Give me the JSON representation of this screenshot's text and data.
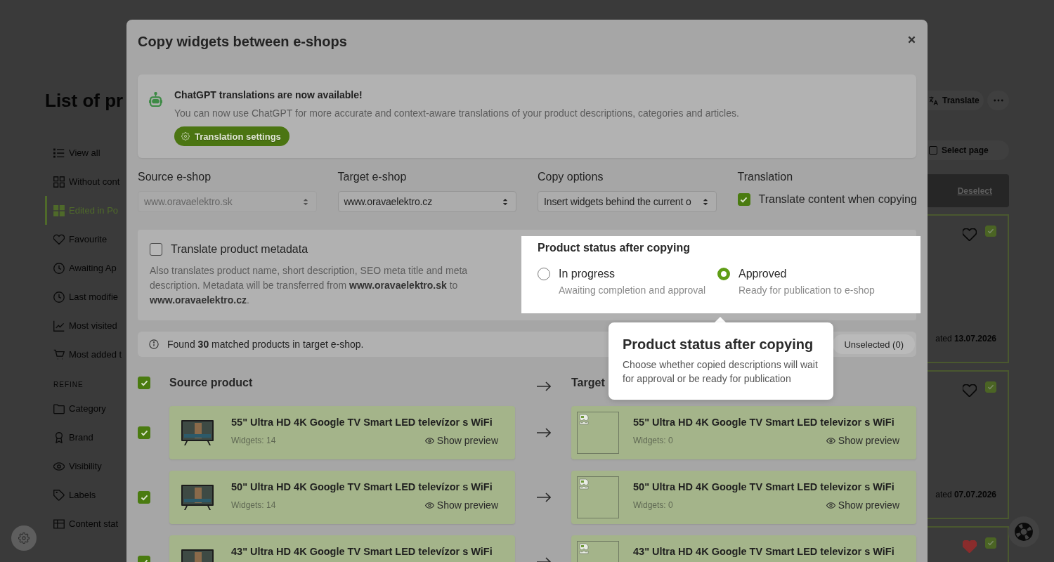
{
  "background": {
    "page_title": "List of pr",
    "sidebar": {
      "views": [
        {
          "label": "View all",
          "selected": false
        },
        {
          "label": "Without cont",
          "selected": false
        },
        {
          "label": "Edited in Po",
          "selected": true
        },
        {
          "label": "Favourite",
          "selected": false
        },
        {
          "label": "Awaiting Ap",
          "selected": false
        },
        {
          "label": "Last modifie",
          "selected": false
        },
        {
          "label": "Most visited",
          "selected": false
        },
        {
          "label": "Most added t",
          "selected": false
        }
      ],
      "section_heading": "REFINE",
      "filters": [
        "Category",
        "Brand",
        "Visibility",
        "Labels",
        "Content stat"
      ]
    },
    "toolbar": {
      "translate_button": "Translate",
      "select_page": {
        "label": "Select page",
        "checked": false
      },
      "deselect_link": "Deselect"
    },
    "cards": [
      {
        "favourite": false,
        "checked": true,
        "updated": "ated **13.07.2026**"
      },
      {
        "favourite": false,
        "checked": true,
        "updated": "ated **07.07.2026**"
      },
      {
        "favourite": true,
        "checked": true
      }
    ]
  },
  "modal": {
    "title": "Copy widgets between e-shops",
    "notice": {
      "title": "ChatGPT translations are now available!",
      "text": "You can now use ChatGPT for more accurate and context-aware translations of your product descriptions, categories and articles.",
      "button": "Translation settings"
    },
    "fields": [
      {
        "kind": "select",
        "label": "Source e-shop",
        "value": "www.oravaelektro.sk",
        "disabled": true
      },
      {
        "kind": "select",
        "label": "Target e-shop",
        "value": "www.oravaelektro.cz",
        "disabled": false
      },
      {
        "kind": "select",
        "label": "Copy options",
        "value": "Insert widgets behind the current o",
        "disabled": false
      },
      {
        "kind": "checkbox",
        "label": "Translation",
        "option": "Translate content when copying",
        "checked": true
      }
    ],
    "metadata": {
      "label": "Translate product metadata",
      "checked": false,
      "description": "Also translates product name, short description, SEO meta title and meta description. Metadata will be transferred from **www.oravaelektro.sk** to **www.oravaelektro.cz**."
    },
    "status": {
      "title": "Product status after copying",
      "options": [
        {
          "label": "In progress",
          "description": "Awaiting completion and approval",
          "selected": false
        },
        {
          "label": "Approved",
          "description": "Ready for publication to e-shop",
          "selected": true
        }
      ]
    },
    "summary": {
      "text": "Found **30** matched products in target e-shop.",
      "unselected_button": "Unselected (0)"
    },
    "list": {
      "all_checked": true,
      "source_heading": "Source product",
      "target_heading": "Target",
      "rows": [
        {
          "checked": true,
          "source": {
            "title": "55\" Ultra HD 4K Google TV Smart LED televízor s WiFi",
            "widgets": "Widgets: 14",
            "preview": "Show preview"
          },
          "target": {
            "title": "55\" Ultra HD 4K Google TV Smart LED televizor s WiFi",
            "widgets": "Widgets: 0",
            "preview": "Show preview"
          }
        },
        {
          "checked": true,
          "source": {
            "title": "50\" Ultra HD 4K Google TV Smart LED televízor s WiFi",
            "widgets": "Widgets: 14",
            "preview": "Show preview"
          },
          "target": {
            "title": "50\" Ultra HD 4K Google TV Smart LED televizor s WiFi",
            "widgets": "Widgets: 0",
            "preview": "Show preview"
          }
        },
        {
          "checked": true,
          "source": {
            "title": "43\" Ultra HD 4K Google TV Smart LED televízor s WiFi"
          },
          "target": {
            "title": "43\" Ultra HD 4K Google TV Smart LED televizor s WiFi"
          }
        }
      ]
    }
  },
  "tooltip": {
    "title": "Product status after copying",
    "text": "Choose whether copied descriptions will wait for approval or be ready for publication"
  }
}
